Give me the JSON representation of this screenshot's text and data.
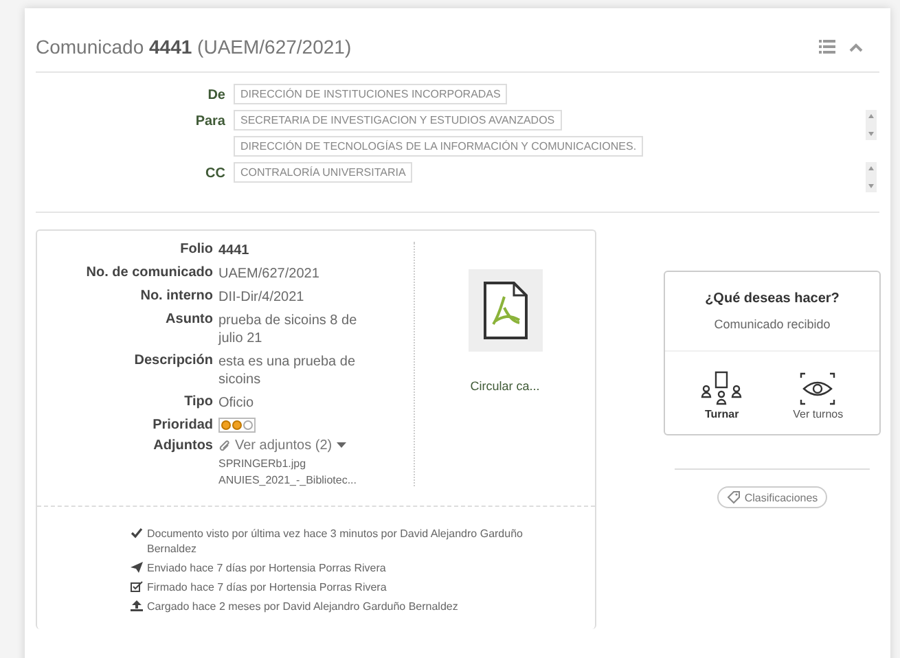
{
  "header": {
    "title": "Comunicado **4441** (UAEM/627/2021)"
  },
  "recipients": [
    {
      "label": "De",
      "values": [
        "DIRECCIÓN DE INSTITUCIONES INCORPORADAS"
      ],
      "scroll": false
    },
    {
      "label": "Para",
      "values": [
        "SECRETARIA DE INVESTIGACION Y ESTUDIOS AVANZADOS",
        "DIRECCIÓN DE TECNOLOGÍAS DE LA INFORMACIÓN Y COMUNICACIONES."
      ],
      "scroll": true
    },
    {
      "label": "CC",
      "values": [
        "CONTRALORÍA UNIVERSITARIA"
      ],
      "scroll": true
    }
  ],
  "details": [
    {
      "kind": "emphasis",
      "label": "Folio",
      "value": "4441"
    },
    {
      "kind": "text",
      "label": "No. de comunicado",
      "value": "UAEM/627/2021"
    },
    {
      "kind": "text",
      "label": "No. interno",
      "value": "DII-Dir/4/2021"
    },
    {
      "kind": "text",
      "label": "Asunto",
      "value": "prueba de sicoins 8 de julio 21"
    },
    {
      "kind": "text",
      "label": "Descripción",
      "value": "esta es una prueba de sicoins"
    },
    {
      "kind": "text",
      "label": "Tipo",
      "value": "Oficio"
    },
    {
      "kind": "priority",
      "label": "Prioridad",
      "dots": [
        {
          "on": true
        },
        {
          "on": true
        },
        {
          "on": false
        }
      ]
    },
    {
      "kind": "attachments",
      "label": "Adjuntos",
      "value": "Ver adjuntos (2)",
      "files": [
        "SPRINGERb1.jpg",
        "ANUIES_2021_-_Bibliotec..."
      ]
    }
  ],
  "document": {
    "name": "Circular ca..."
  },
  "history": [
    {
      "kind": "viewed",
      "text": "Documento visto por última vez hace 3 minutos por David Alejandro Garduño Bernaldez"
    },
    {
      "kind": "sent",
      "text": "Enviado hace 7 días por Hortensia Porras Rivera"
    },
    {
      "kind": "signed",
      "text": "Firmado hace 7 días por Hortensia Porras Rivera"
    },
    {
      "kind": "uploaded",
      "text": "Cargado hace 2 meses por David Alejandro Garduño Bernaldez"
    }
  ],
  "actions": {
    "title": "¿Qué deseas hacer?",
    "status": "Comunicado recibido",
    "buttons": [
      {
        "kind": "turn",
        "label": "Turnar",
        "selected": true
      },
      {
        "kind": "view",
        "label": "Ver turnos",
        "selected": false
      }
    ]
  },
  "classifications": {
    "label": "Clasificaciones"
  }
}
